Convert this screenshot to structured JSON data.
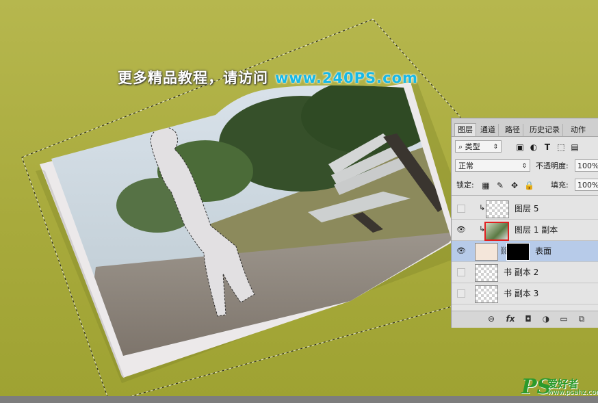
{
  "banner": {
    "chinese": "更多精品教程，请访问",
    "url": "www.240PS.com"
  },
  "panel": {
    "tabs": [
      "图层",
      "通道",
      "路径",
      "历史记录",
      "动作"
    ],
    "filter_type": "类型",
    "blend_mode": "正常",
    "opacity_label": "不透明度:",
    "opacity_value": "100%",
    "lock_label": "锁定:",
    "fill_label": "填充:",
    "fill_value": "100%",
    "layers": [
      {
        "name": "图层 5",
        "visible": false,
        "selected": false
      },
      {
        "name": "图层 1 副本",
        "visible": true,
        "selected": false
      },
      {
        "name": "表面",
        "visible": true,
        "selected": true
      },
      {
        "name": "书 副本 2",
        "visible": false,
        "selected": false
      },
      {
        "name": "书 副本 3",
        "visible": false,
        "selected": false
      }
    ]
  },
  "watermark": {
    "logo": "PS",
    "text_cn": "爱好者",
    "url": "www.psahz.com"
  },
  "colors": {
    "background": "#aeaf44",
    "panel": "#e4e4e4",
    "selected_layer": "#b7cbe9",
    "highlight_box": "#e02020",
    "url_blue": "#17b8e6",
    "logo_green": "#2c9a2c"
  }
}
